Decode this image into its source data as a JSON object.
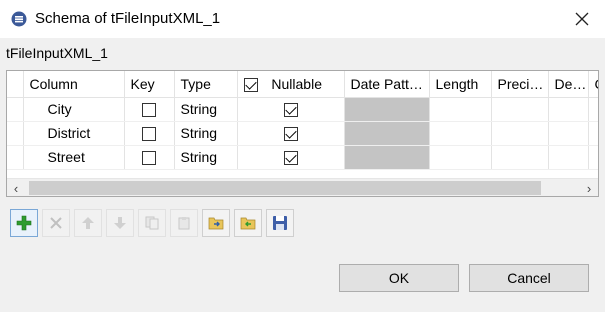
{
  "window": {
    "title": "Schema of tFileInputXML_1",
    "icon": "app-logo-icon"
  },
  "schema": {
    "name": "tFileInputXML_1"
  },
  "table": {
    "headers": [
      "Column",
      "Key",
      "Type",
      "Nullable",
      "Date Patt…",
      "Length",
      "Preci…",
      "De…",
      "C"
    ],
    "header_nullable_checked": true,
    "rows": [
      {
        "column": "City",
        "key": false,
        "type": "String",
        "nullable": true
      },
      {
        "column": "District",
        "key": false,
        "type": "String",
        "nullable": true
      },
      {
        "column": "Street",
        "key": false,
        "type": "String",
        "nullable": true
      }
    ]
  },
  "toolbar": {
    "buttons": [
      {
        "icon": "add-icon",
        "enabled": true
      },
      {
        "icon": "remove-icon",
        "enabled": false
      },
      {
        "icon": "move-up-icon",
        "enabled": false
      },
      {
        "icon": "move-down-icon",
        "enabled": false
      },
      {
        "icon": "copy-icon",
        "enabled": false
      },
      {
        "icon": "paste-icon",
        "enabled": false
      },
      {
        "icon": "import-icon",
        "enabled": true
      },
      {
        "icon": "export-icon",
        "enabled": true
      },
      {
        "icon": "save-icon",
        "enabled": true
      }
    ]
  },
  "buttons": {
    "ok": "OK",
    "cancel": "Cancel"
  },
  "colors": {
    "date_cell": "#c4c4c4",
    "window_bg": "#f0f0f0",
    "add_green": "#2e9b2e"
  }
}
